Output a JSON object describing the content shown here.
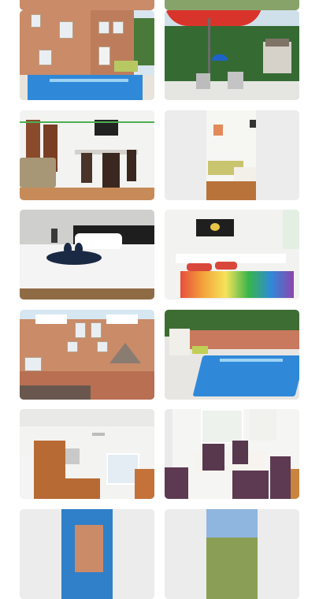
{
  "gallery": {
    "photos": [
      {
        "subject": "villa-pool"
      },
      {
        "subject": "terrace-umbrella"
      },
      {
        "subject": "living-dining"
      },
      {
        "subject": "twin-bedroom"
      },
      {
        "subject": "double-bed-swans"
      },
      {
        "subject": "bedroom-colorful-cover"
      },
      {
        "subject": "house-facade"
      },
      {
        "subject": "pool-garden"
      },
      {
        "subject": "kitchen"
      },
      {
        "subject": "dining-chairs"
      },
      {
        "subject": "exterior-partial-1"
      },
      {
        "subject": "exterior-partial-2"
      }
    ]
  },
  "colors": {
    "wall": "#c98b68",
    "pool": "#2f89d8",
    "sky": "#d7e6f1",
    "bedspread": "#f4f4f4",
    "rainbow": [
      "#e74d3c",
      "#f3a33a",
      "#f6e35a",
      "#39b54a",
      "#2f89d8",
      "#8e44ad"
    ]
  }
}
